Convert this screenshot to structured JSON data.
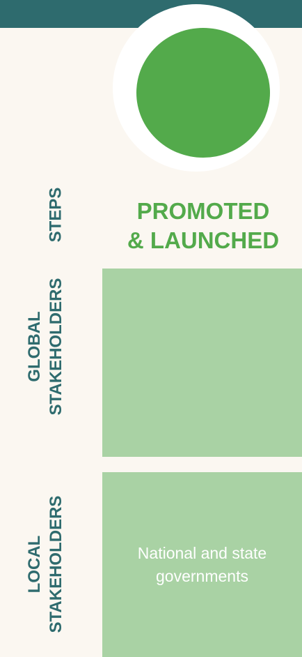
{
  "colors": {
    "teal": "#2E6B6E",
    "green": "#53AA4B",
    "light_green": "#A9D2A4",
    "background": "#FBF7F1"
  },
  "row_labels": {
    "steps": "STEPS",
    "global": {
      "line1": "GLOBAL",
      "line2": "STAKEHOLDERS"
    },
    "local": {
      "line1": "LOCAL",
      "line2": "STAKEHOLDERS"
    }
  },
  "step": {
    "title_line1": "PROMOTED",
    "title_line2": "& LAUNCHED"
  },
  "global_box": {
    "text": ""
  },
  "local_box": {
    "text_line1": "National and state",
    "text_line2": "governments"
  }
}
